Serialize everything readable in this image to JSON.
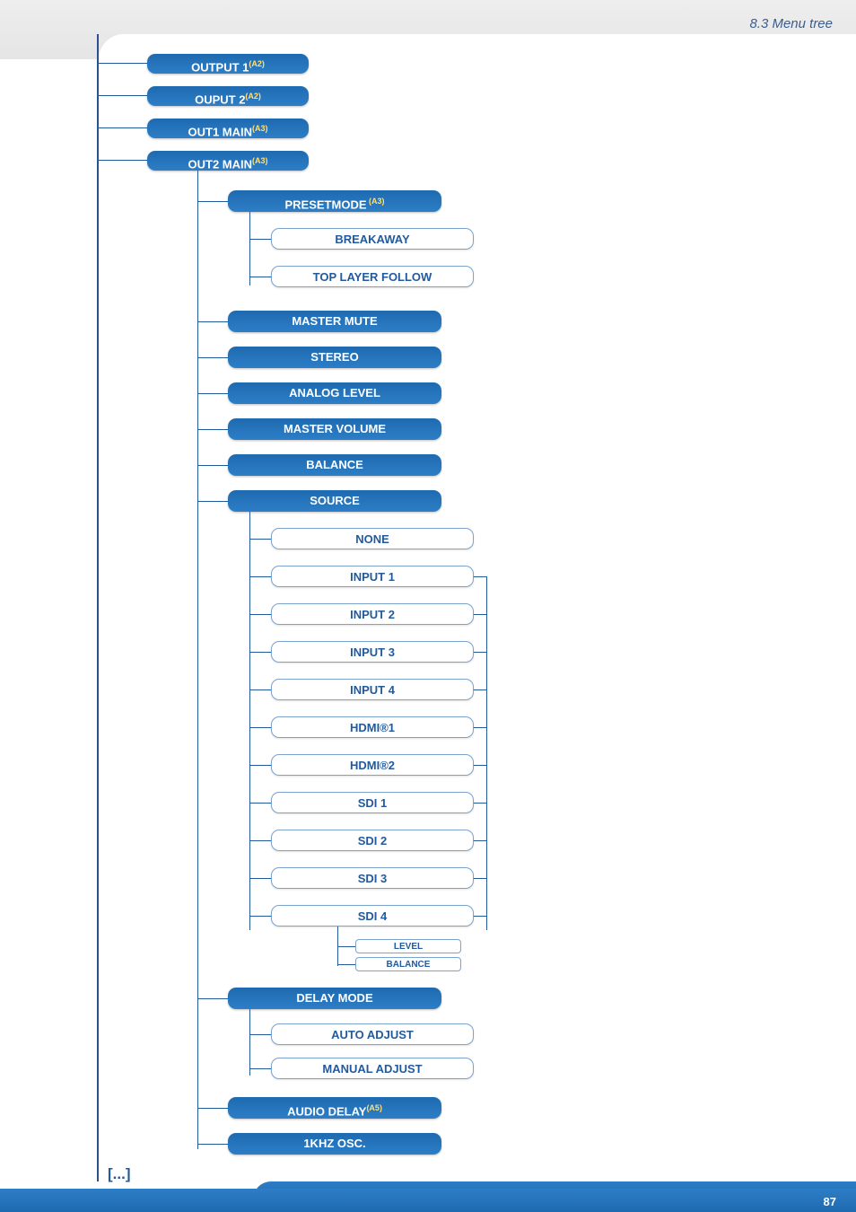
{
  "breadcrumb": "8.3 Menu tree",
  "continuation": "[...]",
  "page_number": "87",
  "nodes": {
    "output1": {
      "label": "OUTPUT 1",
      "sup": "(A2)"
    },
    "ouput2": {
      "label": "OUPUT 2",
      "sup": "(A2)"
    },
    "out1main": {
      "label": "OUT1 MAIN",
      "sup": "(A3)"
    },
    "out2main": {
      "label": "OUT2 MAIN",
      "sup": "(A3)"
    },
    "presetmode": {
      "label": "PRESETMODE",
      "sup": " (A3)"
    },
    "breakaway": "BREAKAWAY",
    "toplayer": "TOP LAYER FOLLOW",
    "mastermute": "MASTER MUTE",
    "stereo": "STEREO",
    "analoglvl": "ANALOG LEVEL",
    "mastervol": "MASTER VOLUME",
    "balance": "BALANCE",
    "source": "SOURCE",
    "none": "NONE",
    "input1": "INPUT 1",
    "input2": "INPUT 2",
    "input3": "INPUT 3",
    "input4": "INPUT 4",
    "hdmi1": "HDMI®1",
    "hdmi2": "HDMI®2",
    "sdi1": "SDI 1",
    "sdi2": "SDI 2",
    "sdi3": "SDI 3",
    "sdi4": "SDI 4",
    "level": "LEVEL",
    "balance2": "BALANCE",
    "delaymode": "DELAY MODE",
    "autoadj": "AUTO ADJUST",
    "manualadj": "MANUAL ADJUST",
    "audiodelay": {
      "label": "AUDIO DELAY",
      "sup": "(A5)"
    },
    "khzosc": "1KHZ OSC."
  }
}
